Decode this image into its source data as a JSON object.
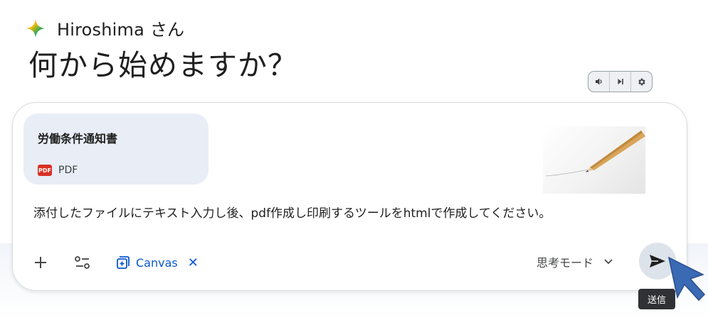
{
  "greeting": {
    "name": "Hiroshima さん",
    "headline": "何から始めますか？"
  },
  "audio_controls": {
    "items": [
      "volume-icon",
      "skip-next-icon",
      "settings-icon"
    ]
  },
  "attachment": {
    "title": "労働条件通知書",
    "type_label": "PDF",
    "badge": "PDF"
  },
  "prompt": {
    "text": "添付したファイルにテキスト入力し後、pdf作成し印刷するツールをhtmlで作成してください。"
  },
  "toolbar": {
    "canvas_label": "Canvas",
    "canvas_close": "✕",
    "mode_label": "思考モード"
  },
  "send": {
    "tooltip": "送信"
  },
  "colors": {
    "accent": "#0b57d0",
    "pdf_badge": "#d93025",
    "chip_bg": "#e8edf6",
    "send_bg": "#dde3ea",
    "cursor": "#3a6ab3"
  }
}
